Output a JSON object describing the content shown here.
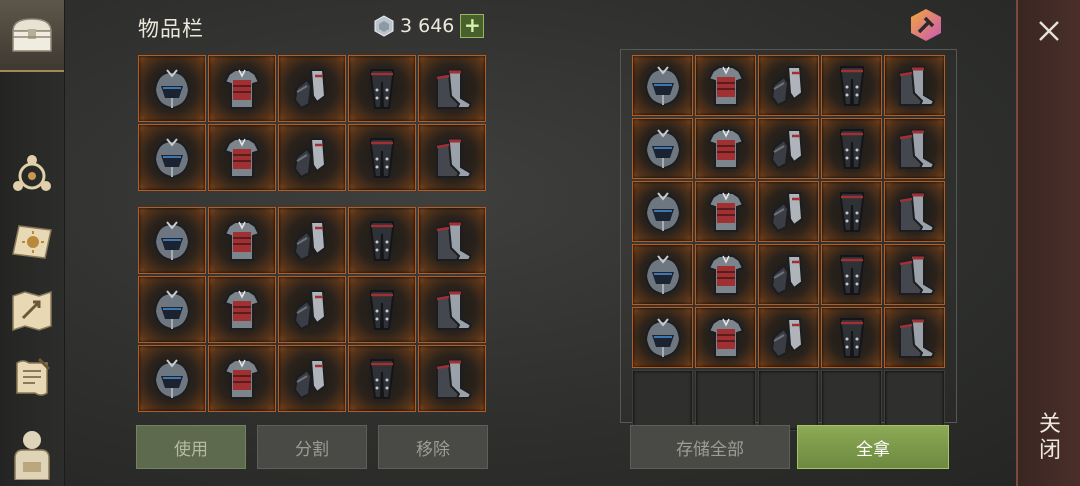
{
  "inventory": {
    "title": "物品栏",
    "currency_amount": "3 646",
    "currency_icon": "silver-coin-icon",
    "rows": [
      [
        "helmet",
        "cuirass",
        "gauntlets",
        "greaves",
        "boots"
      ],
      [
        "helmet",
        "cuirass",
        "gauntlets",
        "greaves",
        "boots"
      ],
      [
        "helmet",
        "cuirass",
        "gauntlets",
        "greaves",
        "boots"
      ],
      [
        "helmet",
        "cuirass",
        "gauntlets",
        "greaves",
        "boots"
      ],
      [
        "helmet",
        "cuirass",
        "gauntlets",
        "greaves",
        "boots"
      ]
    ],
    "buttons": {
      "use": "使用",
      "split": "分割",
      "remove": "移除"
    }
  },
  "container": {
    "rows": [
      [
        "helmet",
        "cuirass",
        "gauntlets",
        "greaves",
        "boots"
      ],
      [
        "helmet",
        "cuirass",
        "gauntlets",
        "greaves",
        "boots"
      ],
      [
        "helmet",
        "cuirass",
        "gauntlets",
        "greaves",
        "boots"
      ],
      [
        "helmet",
        "cuirass",
        "gauntlets",
        "greaves",
        "boots"
      ],
      [
        "helmet",
        "cuirass",
        "gauntlets",
        "greaves",
        "boots"
      ],
      [
        "",
        "",
        "",
        "",
        ""
      ]
    ],
    "buttons": {
      "store_all": "存储全部",
      "take_all": "全拿"
    }
  },
  "sidebar": {
    "items": [
      {
        "icon": "chest-icon",
        "active": true
      },
      {
        "icon": "skills-icon",
        "active": false
      },
      {
        "icon": "book-icon",
        "active": false
      },
      {
        "icon": "map-icon",
        "active": false
      },
      {
        "icon": "scroll-icon",
        "active": false
      },
      {
        "icon": "backpack-icon",
        "active": false
      }
    ]
  },
  "close_panel": {
    "label": "关闭"
  },
  "colors": {
    "slot_border": "#b35d26",
    "take_button": "#7d9a49",
    "accent": "#a38a5a"
  }
}
